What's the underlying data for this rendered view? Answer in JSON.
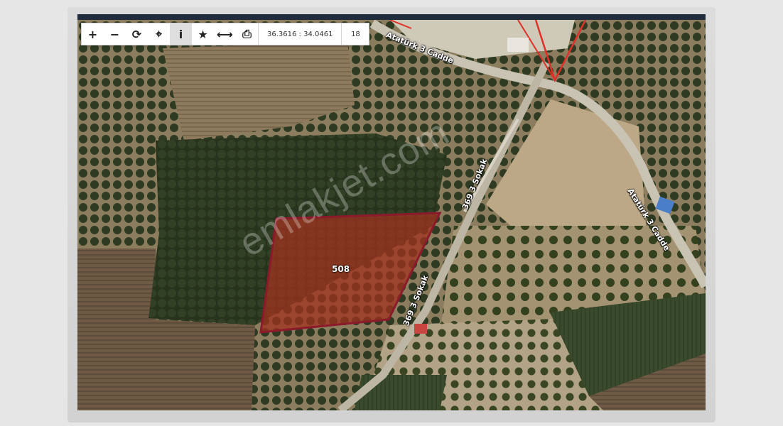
{
  "toolbar": {
    "zoom_in_icon": "plus-icon",
    "zoom_out_icon": "minus-icon",
    "refresh_icon": "refresh-icon",
    "locate_icon": "crosshair-icon",
    "info_icon": "info-icon",
    "favorite_icon": "star-icon",
    "measure_icon": "arrows-horizontal-icon",
    "print_icon": "printer-icon",
    "coordinates": "36.3616 : 34.0461",
    "zoom_level": "18"
  },
  "map": {
    "streets": {
      "ataturk_top": "Atatürk 3 Cadde",
      "ataturk_right": "Atatürk 3 Cadde",
      "sokak_upper": "369 3 Sokak",
      "sokak_lower": "369 3 Sokak"
    },
    "parcel": {
      "number": "508",
      "outline_color": "#8b1a2b",
      "fill_color": "#a0331f"
    },
    "watermark": "emlakjet.com",
    "colors": {
      "trees": "#2f3d22",
      "soil": "#9c8a68",
      "road": "#c9c3b4",
      "boundary": "#e0302a"
    }
  }
}
